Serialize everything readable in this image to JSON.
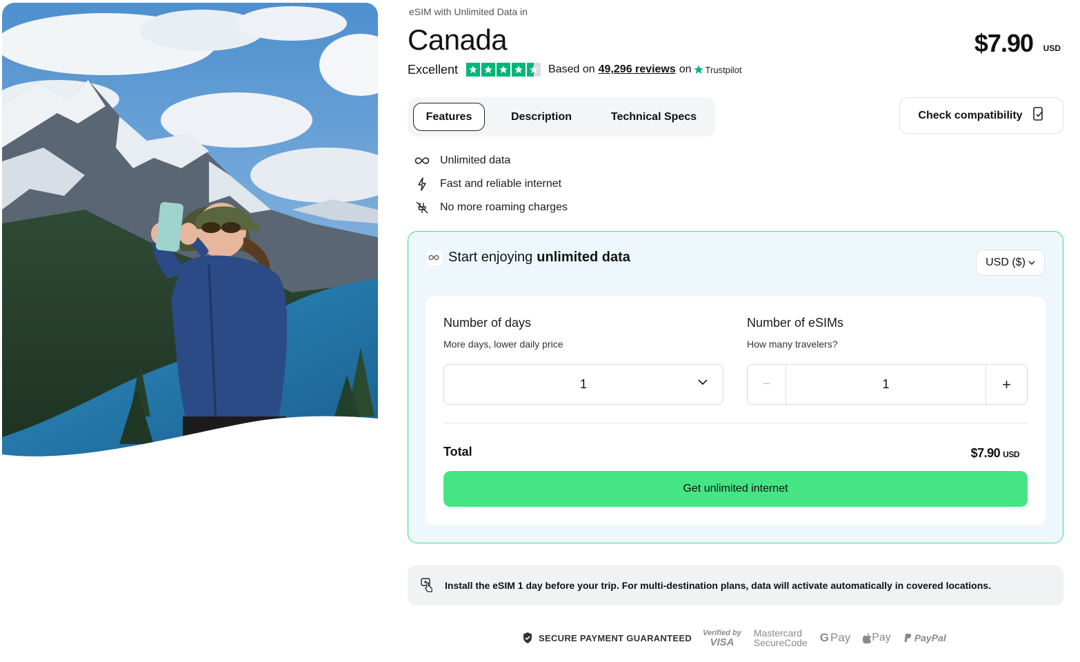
{
  "product": {
    "eyebrow": "eSIM with Unlimited Data in",
    "title": "Canada",
    "price": "$7.90",
    "currency": "USD"
  },
  "rating": {
    "label": "Excellent",
    "stars": 4.5,
    "based_on": "Based on",
    "reviews": "49,296 reviews",
    "on": "on",
    "provider": "Trustpilot",
    "star_color": "#00b67a"
  },
  "tabs": [
    {
      "label": "Features",
      "active": true
    },
    {
      "label": "Description",
      "active": false
    },
    {
      "label": "Technical Specs",
      "active": false
    }
  ],
  "compat_button": {
    "label": "Check compatibility",
    "icon": "phone-check-icon"
  },
  "features": [
    {
      "icon": "infinity-icon",
      "label": "Unlimited data"
    },
    {
      "icon": "lightning-icon",
      "label": "Fast and reliable internet"
    },
    {
      "icon": "no-roaming-icon",
      "label": "No more roaming charges"
    }
  ],
  "purchase": {
    "heading_prefix": "Start enjoying",
    "heading_bold": "unlimited data",
    "currency_select": "USD ($)",
    "days": {
      "label": "Number of days",
      "sub": "More days, lower daily price",
      "value": "1"
    },
    "esims": {
      "label": "Number of eSIMs",
      "sub": "How many travelers?",
      "value": "1",
      "minus": "−",
      "plus": "+"
    },
    "total_label": "Total",
    "total_value": "$7.90",
    "total_currency": "USD",
    "cta": "Get unlimited internet",
    "accent": "#45e585",
    "border": "#3ddc84"
  },
  "info_banner": {
    "icon": "touch-phone-icon",
    "text": "Install the eSIM 1 day before your trip. For multi-destination plans, data will activate automatically in covered locations."
  },
  "payments": {
    "secure_label": "SECURE PAYMENT GUARANTEED",
    "visa_line1": "Verified by",
    "visa_line2": "VISA",
    "mc_line1": "Mastercard",
    "mc_line2": "SecureCode",
    "gpay": "Pay",
    "gpay_g": "G",
    "apay": "Pay",
    "paypal": "PayPal"
  }
}
